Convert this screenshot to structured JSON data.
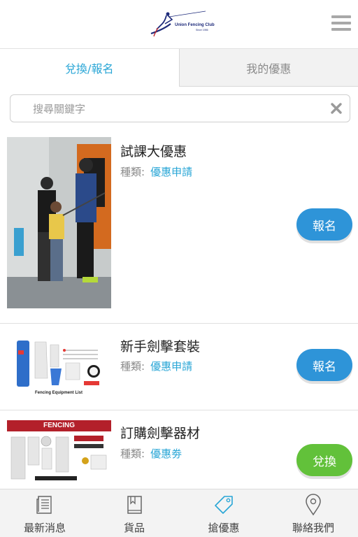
{
  "header": {
    "logo_text": "Union Fencing Club",
    "logo_sub": "Since 1986"
  },
  "tabs": [
    {
      "label": "兌換/報名",
      "active": true
    },
    {
      "label": "我的優惠",
      "active": false
    }
  ],
  "search": {
    "placeholder": "搜尋關鍵字",
    "value": ""
  },
  "items": [
    {
      "title": "試課大優惠",
      "type_label": "種類:",
      "type_value": "優惠申請",
      "button": "報名",
      "button_color": "#2e94d8"
    },
    {
      "title": "新手劍擊套裝",
      "type_label": "種類:",
      "type_value": "優惠申請",
      "button": "報名",
      "button_color": "#2e94d8",
      "image_caption": "Fencing Equipment List"
    },
    {
      "title": "訂購劍擊器材",
      "type_label": "種類:",
      "type_value": "優惠劵",
      "button": "兌換",
      "button_color": "#62c13a",
      "image_banner": "FENCING"
    }
  ],
  "bottom_nav": [
    {
      "label": "最新消息",
      "icon": "newspaper-icon"
    },
    {
      "label": "貨品",
      "icon": "book-icon"
    },
    {
      "label": "搶優惠",
      "icon": "tag-icon",
      "active": true
    },
    {
      "label": "聯絡我們",
      "icon": "location-pin-icon"
    }
  ],
  "colors": {
    "accent": "#29a6d6",
    "button_blue": "#2e94d8",
    "button_green": "#62c13a"
  }
}
